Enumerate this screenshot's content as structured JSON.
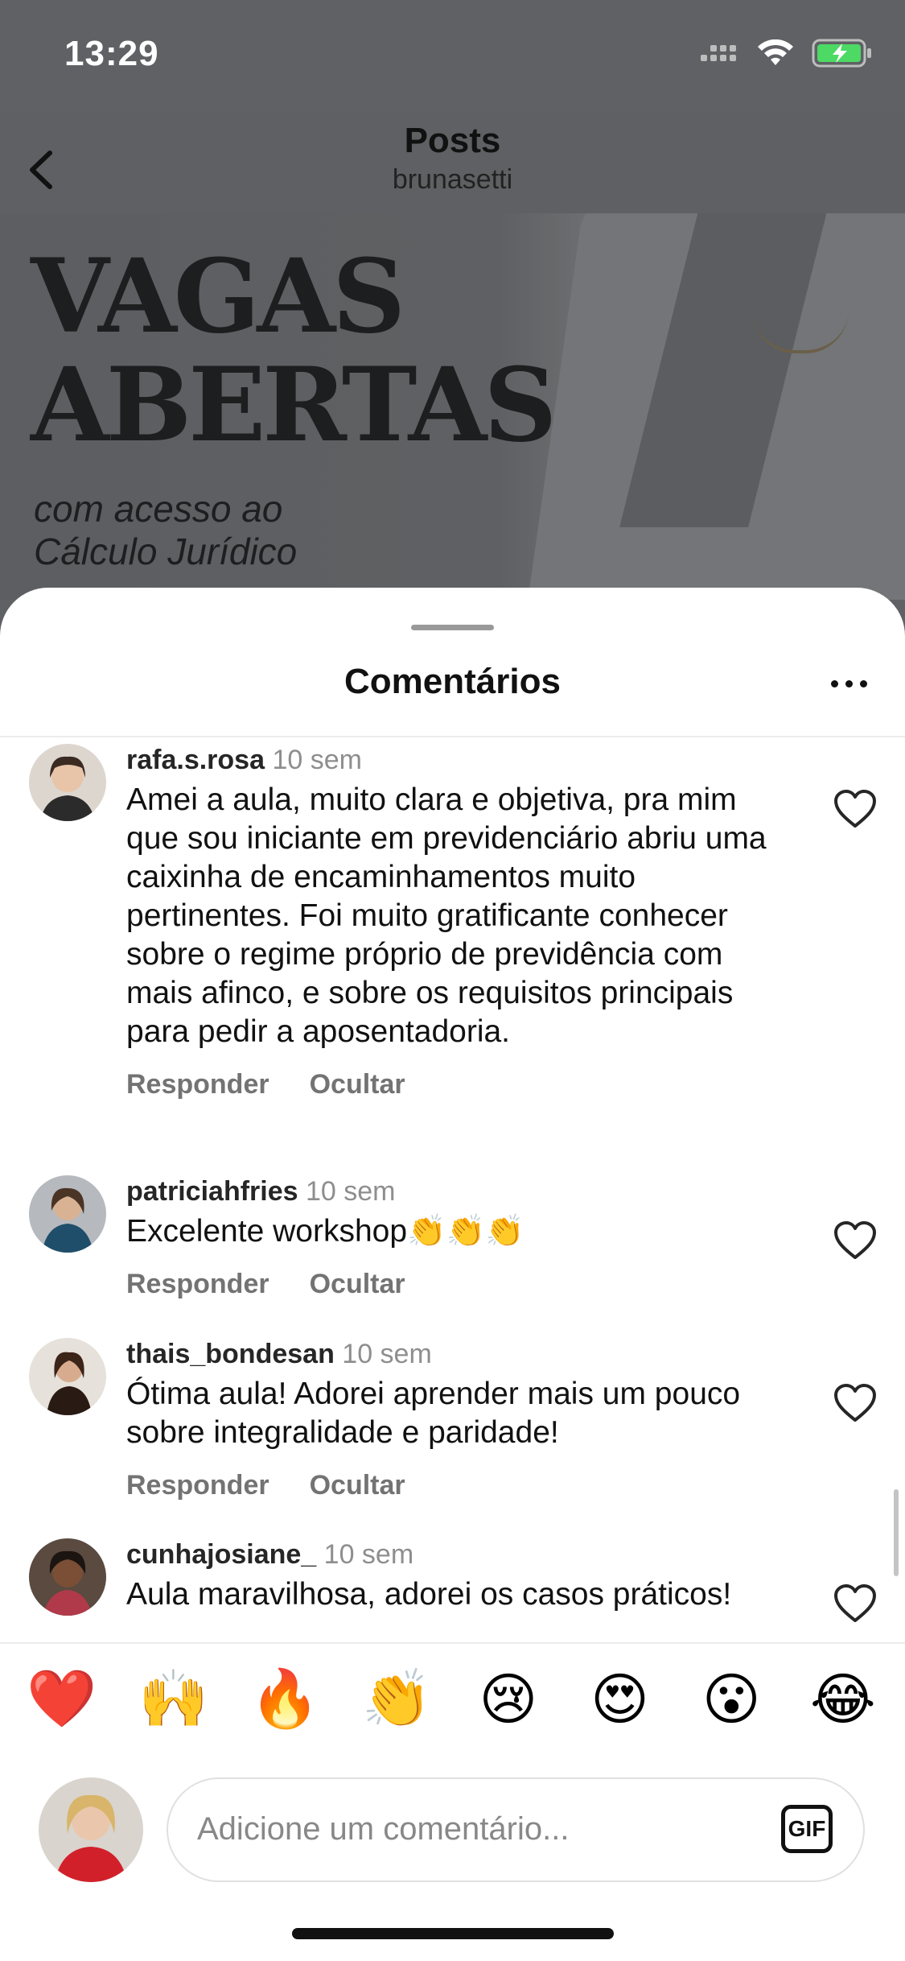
{
  "status_bar": {
    "time": "13:29"
  },
  "header": {
    "title": "Posts",
    "subtitle": "brunasetti"
  },
  "post": {
    "headline_line1": "VAGAS",
    "headline_line2": "ABERTAS",
    "subline_1": "com acesso ao",
    "subline_2": "Cálculo Jurídico"
  },
  "sheet": {
    "title": "Comentários"
  },
  "comments": [
    {
      "username": "rafa.s.rosa",
      "time": "10 sem",
      "text": "Amei a aula, muito clara e objetiva, pra mim que sou iniciante em previdenciário abriu uma caixinha de encaminhamentos muito pertinentes. Foi muito gratificante conhecer sobre o regime próprio de previdência com mais afinco, e sobre os requisitos principais para pedir a aposentadoria.",
      "reply_label": "Responder",
      "hide_label": "Ocultar"
    },
    {
      "username": "patriciahfries",
      "time": "10 sem",
      "text": "Excelente workshop👏👏👏",
      "reply_label": "Responder",
      "hide_label": "Ocultar"
    },
    {
      "username": "thais_bondesan",
      "time": "10 sem",
      "text": "Ótima aula! Adorei aprender mais um pouco sobre integralidade e paridade!",
      "reply_label": "Responder",
      "hide_label": "Ocultar"
    },
    {
      "username": "cunhajosiane_",
      "time": "10 sem",
      "text": "Aula maravilhosa, adorei os casos práticos!"
    }
  ],
  "quick_reactions": [
    "❤️",
    "🙌",
    "🔥",
    "👏",
    "😢",
    "😍",
    "😮",
    "😂"
  ],
  "composer": {
    "placeholder": "Adicione um comentário...",
    "gif_label": "GIF"
  },
  "colors": {
    "accent_text": "#111111",
    "muted_text": "#737373",
    "timestamp": "#8e8e8e",
    "battery_green": "#4cd964"
  }
}
